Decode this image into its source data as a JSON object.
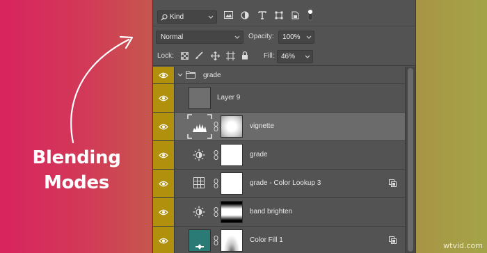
{
  "promo": {
    "line1": "Blending",
    "line2": "Modes"
  },
  "filter_bar": {
    "kind_label": "Kind",
    "icons": [
      "image-filter-icon",
      "adjustment-filter-icon",
      "type-filter-icon",
      "shape-filter-icon",
      "smart-object-filter-icon",
      "filter-toggle-icon"
    ]
  },
  "blend": {
    "mode": "Normal",
    "opacity_label": "Opacity:",
    "opacity_value": "100%"
  },
  "lock": {
    "label": "Lock:",
    "fill_label": "Fill:",
    "fill_value": "46%"
  },
  "layers": [
    {
      "name": "grade",
      "type": "group"
    },
    {
      "name": "Layer 9",
      "type": "pixel"
    },
    {
      "name": "vignette",
      "type": "levels-adjustment",
      "selected": true
    },
    {
      "name": "grade",
      "type": "brightness-adjustment"
    },
    {
      "name": "grade - Color Lookup 3",
      "type": "color-lookup-adjustment"
    },
    {
      "name": "band brighten",
      "type": "brightness-adjustment"
    },
    {
      "name": "Color Fill 1",
      "type": "color-fill"
    }
  ],
  "watermark": "wtvid.com",
  "colors": {
    "eye_column": "#b0900d",
    "panel": "#535353",
    "selected_row": "#6b6b6b"
  }
}
